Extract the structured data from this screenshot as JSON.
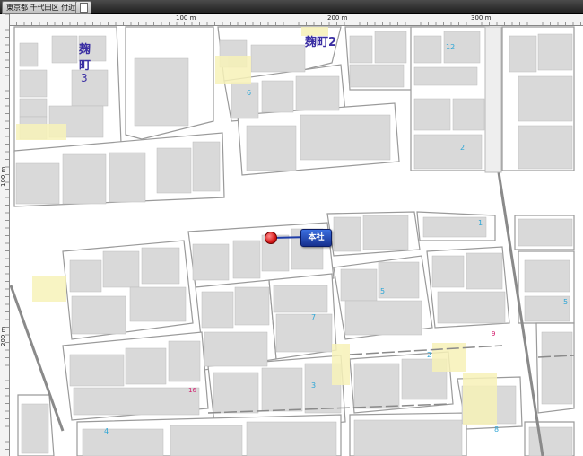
{
  "window": {
    "tab_title": "東京都 千代田区 付近",
    "tab_icon": "page-icon"
  },
  "ruler": {
    "top": [
      "100 m",
      "200 m",
      "300 m"
    ],
    "left": [
      "100 m",
      "200 m"
    ]
  },
  "map": {
    "district_labels": {
      "left_line1": "麹",
      "left_line2": "町",
      "left_number": "3",
      "right": "麹町2"
    },
    "block_numbers_blue": [
      "12",
      "6",
      "2",
      "1",
      "5",
      "7",
      "5",
      "2",
      "3",
      "4",
      "8"
    ],
    "block_numbers_red": [
      "9",
      "16"
    ],
    "marker": {
      "label": "本社",
      "icon": "location-pin-icon",
      "color": "#d71a1a"
    }
  },
  "colors": {
    "building": "#d9d9d9",
    "highlight": "#f7f2b8",
    "label_blue": "#2ea6d6",
    "label_red": "#d21c6c",
    "district_purple": "#3b2fa3"
  }
}
